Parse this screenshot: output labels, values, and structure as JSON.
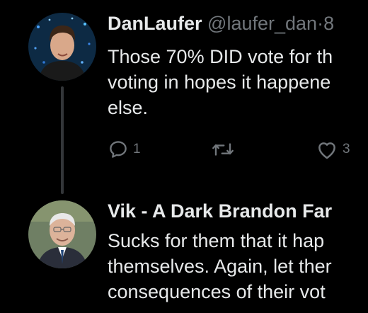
{
  "tweets": [
    {
      "display_name": "DanLaufer",
      "handle": "@laufer_dan",
      "separator": "·",
      "time": "8",
      "text_lines": [
        "Those 70% DID vote for th",
        "voting in hopes it happene",
        "else."
      ],
      "actions": {
        "reply_count": "1",
        "retweet_count": "",
        "like_count": "3"
      }
    },
    {
      "display_name": "Vik - A Dark Brandon Far",
      "text_lines": [
        "Sucks for them that it hap",
        "themselves. Again, let ther",
        "consequences of their vot"
      ]
    }
  ],
  "icons": {
    "reply": "reply-icon",
    "retweet": "retweet-icon",
    "like": "heart-icon"
  },
  "colors": {
    "background": "#000000",
    "primary_text": "#e7e9ea",
    "secondary_text": "#71767b",
    "thread_line": "#333639"
  }
}
